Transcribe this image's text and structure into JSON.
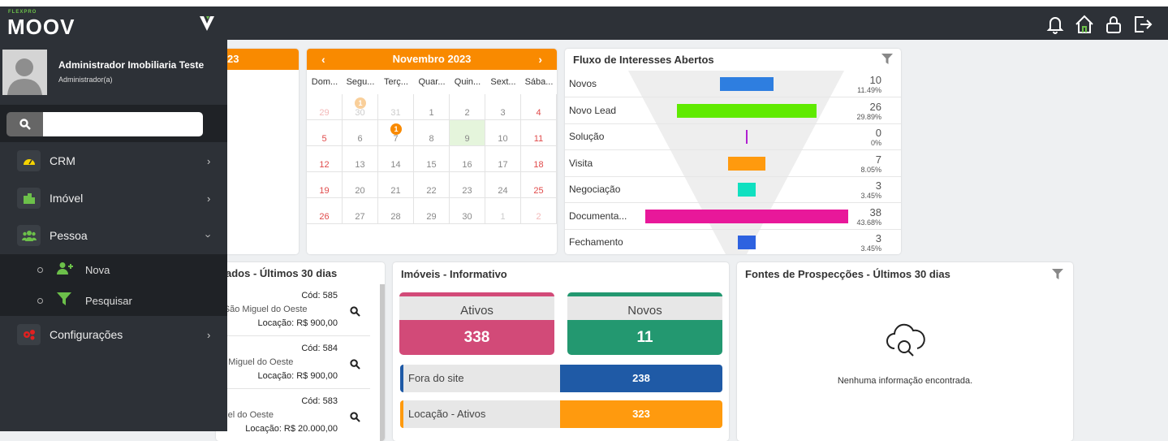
{
  "brand": {
    "small": "FLEXPRO",
    "name": "MOOV"
  },
  "user": {
    "name": "Administrador Imobiliaria Teste",
    "role": "Administrador(a)"
  },
  "search": {
    "placeholder": ""
  },
  "menu": {
    "items": [
      {
        "label": "CRM",
        "icon": "speedometer-icon",
        "color": "#f5d300"
      },
      {
        "label": "Imóvel",
        "icon": "buildings-icon",
        "color": "#6cc04a"
      },
      {
        "label": "Pessoa",
        "icon": "people-icon",
        "color": "#6cc04a"
      },
      {
        "label": "Configurações",
        "icon": "cogs-icon",
        "color": "#e02020"
      }
    ],
    "pessoa_sub": [
      {
        "label": "Nova",
        "icon": "add-user-icon"
      },
      {
        "label": "Pesquisar",
        "icon": "filter-icon"
      }
    ]
  },
  "left_card": {
    "header_partial": "23"
  },
  "calendar": {
    "month": "Novembro 2023",
    "weekdays": [
      "Dom...",
      "Segu...",
      "Terç...",
      "Quar...",
      "Quin...",
      "Sext...",
      "Sába..."
    ],
    "weeks": [
      [
        "29",
        "30",
        "31",
        "1",
        "2",
        "3",
        "4"
      ],
      [
        "5",
        "6",
        "7",
        "8",
        "9",
        "10",
        "11"
      ],
      [
        "12",
        "13",
        "14",
        "15",
        "16",
        "17",
        "18"
      ],
      [
        "19",
        "20",
        "21",
        "22",
        "23",
        "24",
        "25"
      ],
      [
        "26",
        "27",
        "28",
        "29",
        "30",
        "1",
        "2"
      ]
    ],
    "badges": {
      "w0d1": "1",
      "w1d2": "1"
    },
    "today": "9"
  },
  "funnel": {
    "title": "Fluxo de Interesses Abertos",
    "rows": [
      {
        "label": "Novos",
        "count": "10",
        "pct": "11.49%",
        "color": "#2e7ee0",
        "value": 10
      },
      {
        "label": "Novo Lead",
        "count": "26",
        "pct": "29.89%",
        "color": "#5fea00",
        "value": 26
      },
      {
        "label": "Solução",
        "count": "0",
        "pct": "0%",
        "color": "#b020d0",
        "value": 0
      },
      {
        "label": "Visita",
        "count": "7",
        "pct": "8.05%",
        "color": "#ff9a0e",
        "value": 7
      },
      {
        "label": "Negociação",
        "count": "3",
        "pct": "3.45%",
        "color": "#10e0c0",
        "value": 3
      },
      {
        "label": "Documenta...",
        "count": "38",
        "pct": "43.68%",
        "color": "#e8189a",
        "value": 38
      },
      {
        "label": "Fechamento",
        "count": "3",
        "pct": "3.45%",
        "color": "#2e62e0",
        "value": 3
      }
    ]
  },
  "properties": {
    "title_partial": "ados - Últimos 30 dias",
    "items": [
      {
        "cod": "Cód: 585",
        "loc": "), São Miguel do Oeste",
        "val": "Locação: R$ 900,00"
      },
      {
        "cod": "Cód: 584",
        "loc": "ão Miguel do Oeste",
        "val": "Locação: R$ 900,00"
      },
      {
        "cod": "Cód: 583",
        "loc": "iguel do Oeste",
        "val": "Locação: R$ 20.000,00"
      }
    ]
  },
  "imoveis": {
    "title": "Imóveis - Informativo",
    "ativos_label": "Ativos",
    "ativos_value": "338",
    "novos_label": "Novos",
    "novos_value": "11",
    "site_label": "Fora do site",
    "site_value": "238",
    "loc_label": "Locação - Ativos",
    "loc_value": "323",
    "colors": {
      "ativos": "#d24a78",
      "novos": "#239870",
      "site": "#1f5aa6",
      "loc": "#ff9a0e"
    }
  },
  "fontes": {
    "title": "Fontes de Prospecções - Últimos 30 dias",
    "empty": "Nenhuma informação encontrada."
  }
}
